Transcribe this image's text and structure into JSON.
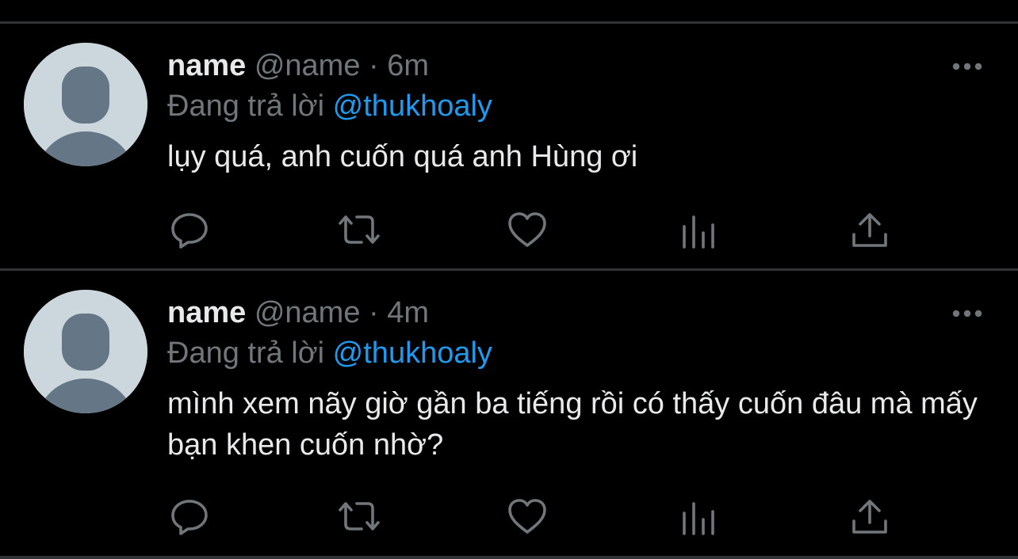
{
  "colors": {
    "background": "#000000",
    "divider": "#2f3336",
    "text_primary": "#e7e9ea",
    "text_secondary": "#71767b",
    "link": "#1d9bf0",
    "avatar_bg": "#ccd6dd",
    "avatar_figure": "#657786"
  },
  "icons": [
    "avatar-placeholder-icon",
    "more-dots-icon",
    "reply-icon",
    "retweet-icon",
    "like-heart-icon",
    "views-chart-icon",
    "share-upload-icon"
  ],
  "tweets": [
    {
      "display_name": "name",
      "handle": "@name",
      "separator": "·",
      "time": "6m",
      "reply_prefix": "Đang trả lời",
      "reply_to": "@thukhoaly",
      "text": "lụy quá, anh cuốn quá anh Hùng ơi"
    },
    {
      "display_name": "name",
      "handle": "@name",
      "separator": "·",
      "time": "4m",
      "reply_prefix": "Đang trả lời",
      "reply_to": "@thukhoaly",
      "text": "mình xem nãy giờ gần ba tiếng rồi có thấy cuốn đâu mà mấy bạn khen cuốn nhờ?"
    }
  ]
}
